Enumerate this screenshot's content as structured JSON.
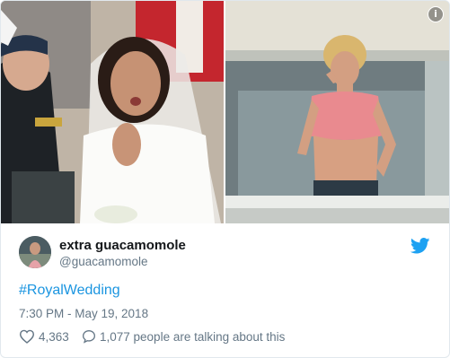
{
  "tweet": {
    "display_name": "extra guacamomole",
    "handle": "@guacamomole",
    "hashtag": "#RoyalWedding",
    "timestamp": "7:30 PM - May 19, 2018",
    "likes": "4,363",
    "replies_text": "1,077 people are talking about this"
  },
  "media": {
    "info_badge": "i",
    "left_photo": "bride-in-veil-photo",
    "right_photo": "woman-on-balcony-photo"
  },
  "icons": {
    "info": "info-icon",
    "bird": "twitter-bird-icon",
    "heart": "heart-icon",
    "reply": "speech-bubble-icon"
  },
  "colors": {
    "link": "#1b95e0",
    "muted": "#657786",
    "text": "#14171a",
    "border": "#e1e8ed"
  }
}
